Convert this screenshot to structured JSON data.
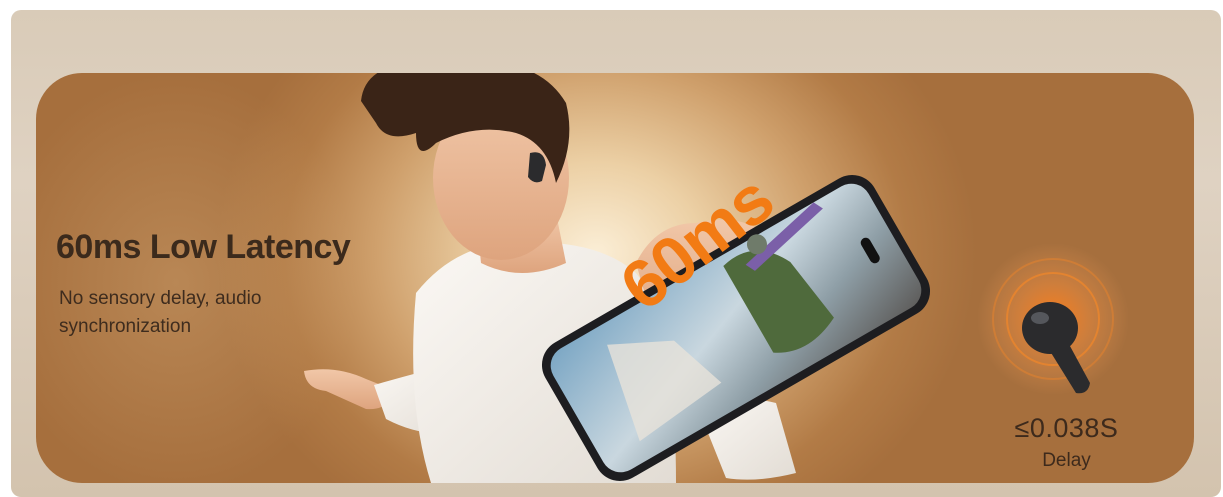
{
  "banner": {
    "headline": "60ms Low Latency",
    "subline": "No sensory delay, audio synchronization",
    "badge": "60ms",
    "delay_value": "≤0.038S",
    "delay_label": "Delay"
  },
  "colors": {
    "accent_orange": "#f27b14",
    "headline_text": "#3b2a1c",
    "banner_light": "#fbeed6",
    "banner_dark": "#a66f3d",
    "earbud": "#2b2b2d"
  },
  "images": {
    "hero_person": "person-icon",
    "phone": "phone-game-icon",
    "earbud": "earbud-icon"
  }
}
